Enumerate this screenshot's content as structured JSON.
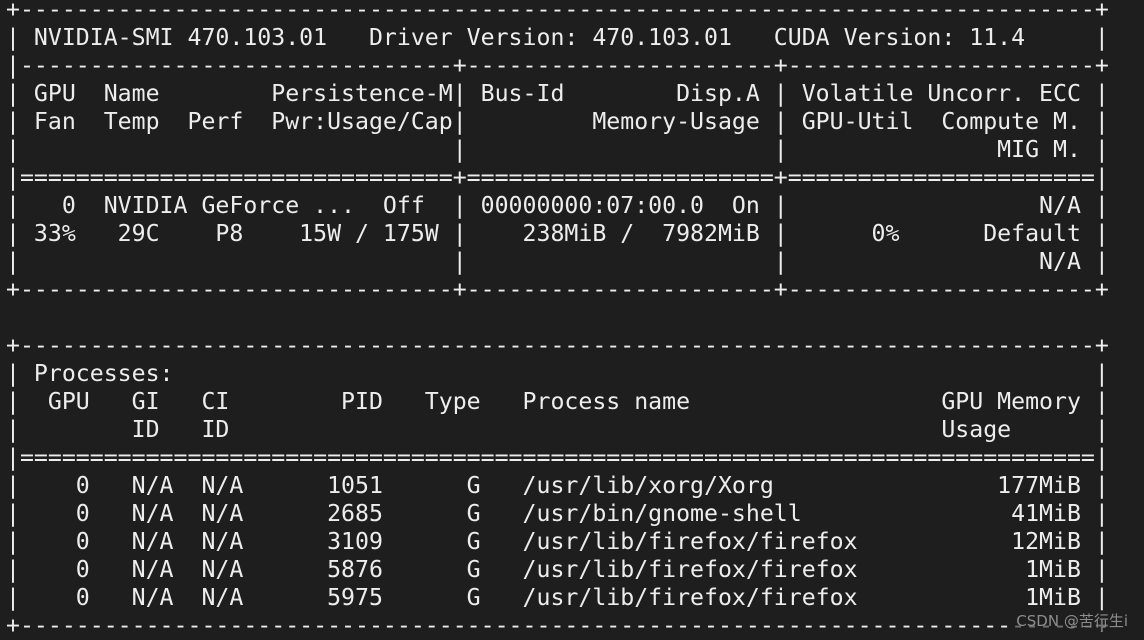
{
  "terminal": {
    "lines": [
      "+-----------------------------------------------------------------------------+",
      "| NVIDIA-SMI 470.103.01   Driver Version: 470.103.01   CUDA Version: 11.4     |",
      "|-------------------------------+----------------------+----------------------+",
      "| GPU  Name        Persistence-M| Bus-Id        Disp.A | Volatile Uncorr. ECC |",
      "| Fan  Temp  Perf  Pwr:Usage/Cap|         Memory-Usage | GPU-Util  Compute M. |",
      "|                               |                      |               MIG M. |",
      "|===============================+======================+======================|",
      "|   0  NVIDIA GeForce ...  Off  | 00000000:07:00.0  On |                  N/A |",
      "| 33%   29C    P8    15W / 175W |    238MiB /  7982MiB |      0%      Default |",
      "|                               |                      |                  N/A |",
      "+-------------------------------+----------------------+----------------------+",
      "",
      "+-----------------------------------------------------------------------------+",
      "| Processes:                                                                  |",
      "|  GPU   GI   CI        PID   Type   Process name                  GPU Memory |",
      "|        ID   ID                                                   Usage      |",
      "|=============================================================================|",
      "|    0   N/A  N/A      1051      G   /usr/lib/xorg/Xorg                177MiB |",
      "|    0   N/A  N/A      2685      G   /usr/bin/gnome-shell               41MiB |",
      "|    0   N/A  N/A      3109      G   /usr/lib/firefox/firefox           12MiB |",
      "|    0   N/A  N/A      5876      G   /usr/lib/firefox/firefox            1MiB |",
      "|    0   N/A  N/A      5975      G   /usr/lib/firefox/firefox            1MiB |",
      "+-----------------------------------------------------------------------------+"
    ]
  },
  "watermark": "CSDN @苦行生i",
  "colors": {
    "background": "#1e1e1e",
    "foreground": "#ededed"
  }
}
